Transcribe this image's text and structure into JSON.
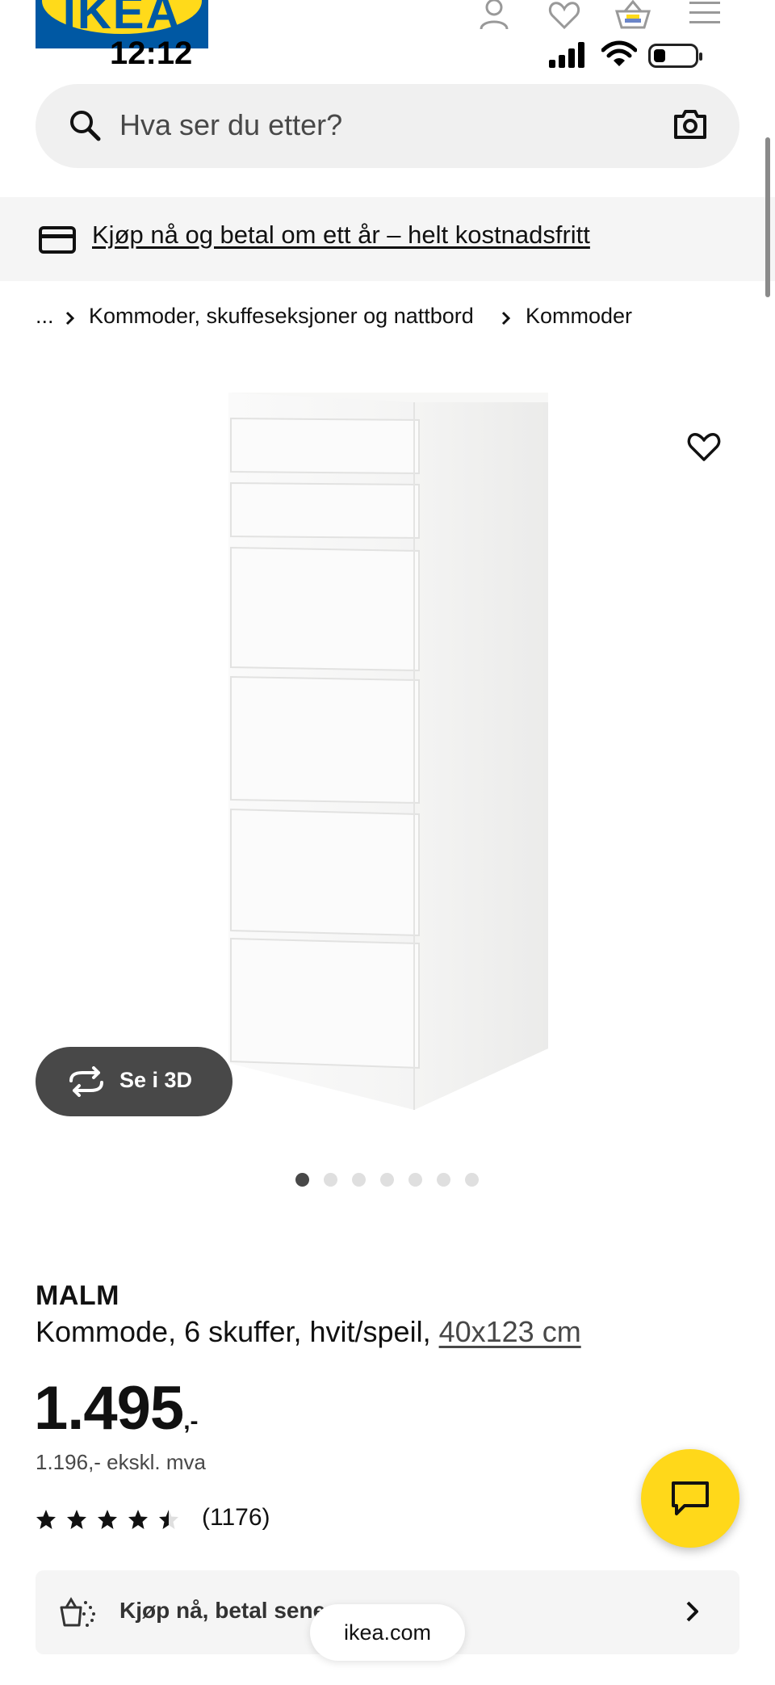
{
  "brand": {
    "logo_text": "IKEA",
    "accent": "#0058a3",
    "logo_yellow": "#ffda1a",
    "chat_yellow": "#ffd81a"
  },
  "status_bar": {
    "time": "12:12"
  },
  "header": {
    "icons": [
      "profile-icon",
      "heart-icon",
      "basket-icon",
      "menu-icon"
    ]
  },
  "search": {
    "placeholder": "Hva ser du etter?"
  },
  "banner": {
    "text": "Kjøp nå og betal om ett år – helt kostnadsfritt"
  },
  "breadcrumb": {
    "ellipsis": "...",
    "items": [
      "Kommoder, skuffeseksjoner og nattbord",
      "Kommoder"
    ]
  },
  "gallery": {
    "view_3d_label": "Se i 3D",
    "image_count": 7,
    "active_index": 0
  },
  "product": {
    "name": "MALM",
    "description": "Kommode, 6 skuffer, hvit/speil,",
    "size_link": "40x123 cm",
    "price_main": "1.495",
    "price_suffix": ",-",
    "price_ex_vat": "1.196,- ekskl. mva",
    "rating": {
      "stars": 4.5,
      "max": 5,
      "count_text": "(1176)"
    }
  },
  "bnpl": {
    "label": "Kjøp nå, betal sene"
  },
  "browser": {
    "url": "ikea.com"
  }
}
